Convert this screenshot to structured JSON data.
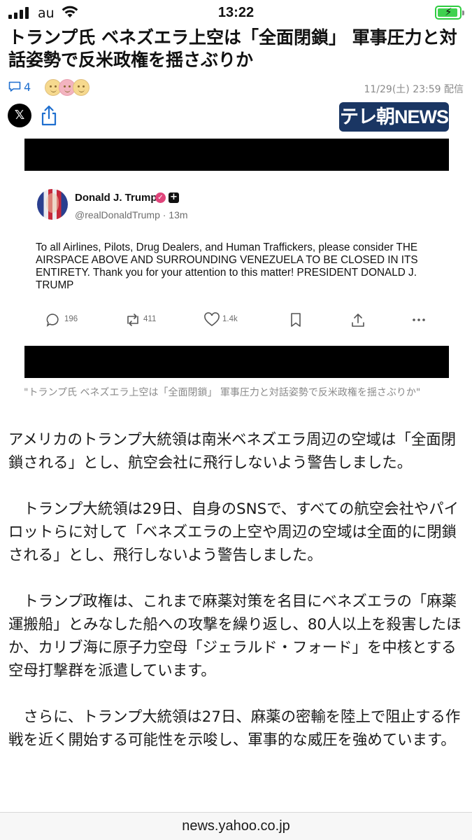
{
  "status_bar": {
    "carrier": "au",
    "time": "13:22",
    "battery_level": 0.92,
    "icons": [
      "signal-icon",
      "wifi-icon",
      "battery-charging-icon"
    ]
  },
  "article": {
    "title": "トランプ氏 ベネズエラ上空は「全面閉鎖」 軍事圧力と対話姿勢で反米政権を揺さぶりか",
    "comment_count": "4",
    "published": "11/29(土) 23:59 配信",
    "source_logo": "テレ朝NEWS",
    "share_icons": [
      "x-logo-icon",
      "share-icon"
    ],
    "image_caption": "\"トランプ氏 ベネズエラ上空は「全面閉鎖」 軍事圧力と対話姿勢で反米政権を揺さぶりか\"",
    "paragraphs": [
      "アメリカのトランプ大統領は南米ベネズエラ周辺の空域は「全面閉鎖される」とし、航空会社に飛行しないよう警告しました。",
      "　トランプ大統領は29日、自身のSNSで、すべての航空会社やパイロットらに対して「ベネズエラの上空や周辺の空域は全面的に閉鎖される」とし、飛行しないよう警告しました。",
      "　トランプ政権は、これまで麻薬対策を名目にベネズエラの「麻薬運搬船」とみなした船への攻撃を繰り返し、80人以上を殺害したほか、カリブ海に原子力空母「ジェラルド・フォード」を中核とする空母打撃群を派遣しています。",
      "　さらに、トランプ大統領は27日、麻薬の密輸を陸上で阻止する作戦を近く開始する可能性を示唆し、軍事的な威圧を強めています。"
    ]
  },
  "tweet": {
    "name": "Donald J. Trump",
    "handle_time": "@realDonaldTrump · 13m",
    "text": "To all Airlines, Pilots, Drug Dealers, and Human Traffickers, please consider THE AIRSPACE ABOVE AND SURROUNDING VENEZUELA TO BE CLOSED IN ITS ENTIRETY. Thank you for your attention to this matter! PRESIDENT DONALD J. TRUMP",
    "replies": "196",
    "reposts": "411",
    "likes": "1.4k"
  },
  "footer": {
    "url": "news.yahoo.co.jp"
  }
}
